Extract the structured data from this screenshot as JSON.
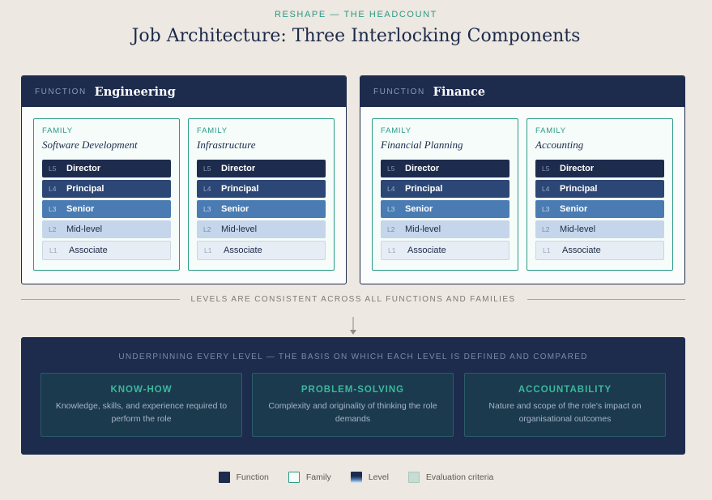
{
  "header": {
    "eyebrow": "RESHAPE — THE HEADCOUNT",
    "title": "Job Architecture: Three Interlocking Components"
  },
  "function_label": "FUNCTION",
  "family_label": "FAMILY",
  "functions": [
    {
      "name": "Engineering",
      "families": [
        {
          "name": "Software Development",
          "levels": [
            {
              "code": "L5",
              "name": "Director"
            },
            {
              "code": "L4",
              "name": "Principal"
            },
            {
              "code": "L3",
              "name": "Senior"
            },
            {
              "code": "L2",
              "name": "Mid-level"
            },
            {
              "code": "L1",
              "name": "Associate"
            }
          ]
        },
        {
          "name": "Infrastructure",
          "levels": [
            {
              "code": "L5",
              "name": "Director"
            },
            {
              "code": "L4",
              "name": "Principal"
            },
            {
              "code": "L3",
              "name": "Senior"
            },
            {
              "code": "L2",
              "name": "Mid-level"
            },
            {
              "code": "L1",
              "name": "Associate"
            }
          ]
        }
      ]
    },
    {
      "name": "Finance",
      "families": [
        {
          "name": "Financial Planning",
          "levels": [
            {
              "code": "L5",
              "name": "Director"
            },
            {
              "code": "L4",
              "name": "Principal"
            },
            {
              "code": "L3",
              "name": "Senior"
            },
            {
              "code": "L2",
              "name": "Mid-level"
            },
            {
              "code": "L1",
              "name": "Associate"
            }
          ]
        },
        {
          "name": "Accounting",
          "levels": [
            {
              "code": "L5",
              "name": "Director"
            },
            {
              "code": "L4",
              "name": "Principal"
            },
            {
              "code": "L3",
              "name": "Senior"
            },
            {
              "code": "L2",
              "name": "Mid-level"
            },
            {
              "code": "L1",
              "name": "Associate"
            }
          ]
        }
      ]
    }
  ],
  "divider_text": "LEVELS ARE CONSISTENT ACROSS ALL FUNCTIONS AND FAMILIES",
  "basis": {
    "title": "UNDERPINNING EVERY LEVEL — THE BASIS ON WHICH EACH LEVEL IS DEFINED AND COMPARED",
    "criteria": [
      {
        "name": "KNOW-HOW",
        "desc": "Knowledge, skills, and experience required to perform the role"
      },
      {
        "name": "PROBLEM-SOLVING",
        "desc": "Complexity and originality of thinking the role demands"
      },
      {
        "name": "ACCOUNTABILITY",
        "desc": "Nature and scope of the role's impact on organisational outcomes"
      }
    ]
  },
  "legend": [
    {
      "label": "Function",
      "swatch": "function"
    },
    {
      "label": "Family",
      "swatch": "family"
    },
    {
      "label": "Level",
      "swatch": "level"
    },
    {
      "label": "Evaluation criteria",
      "swatch": "evaluation"
    }
  ],
  "colors": {
    "navy": "#1d2b4d",
    "teal": "#2a9a85",
    "background": "#ede8e2"
  }
}
